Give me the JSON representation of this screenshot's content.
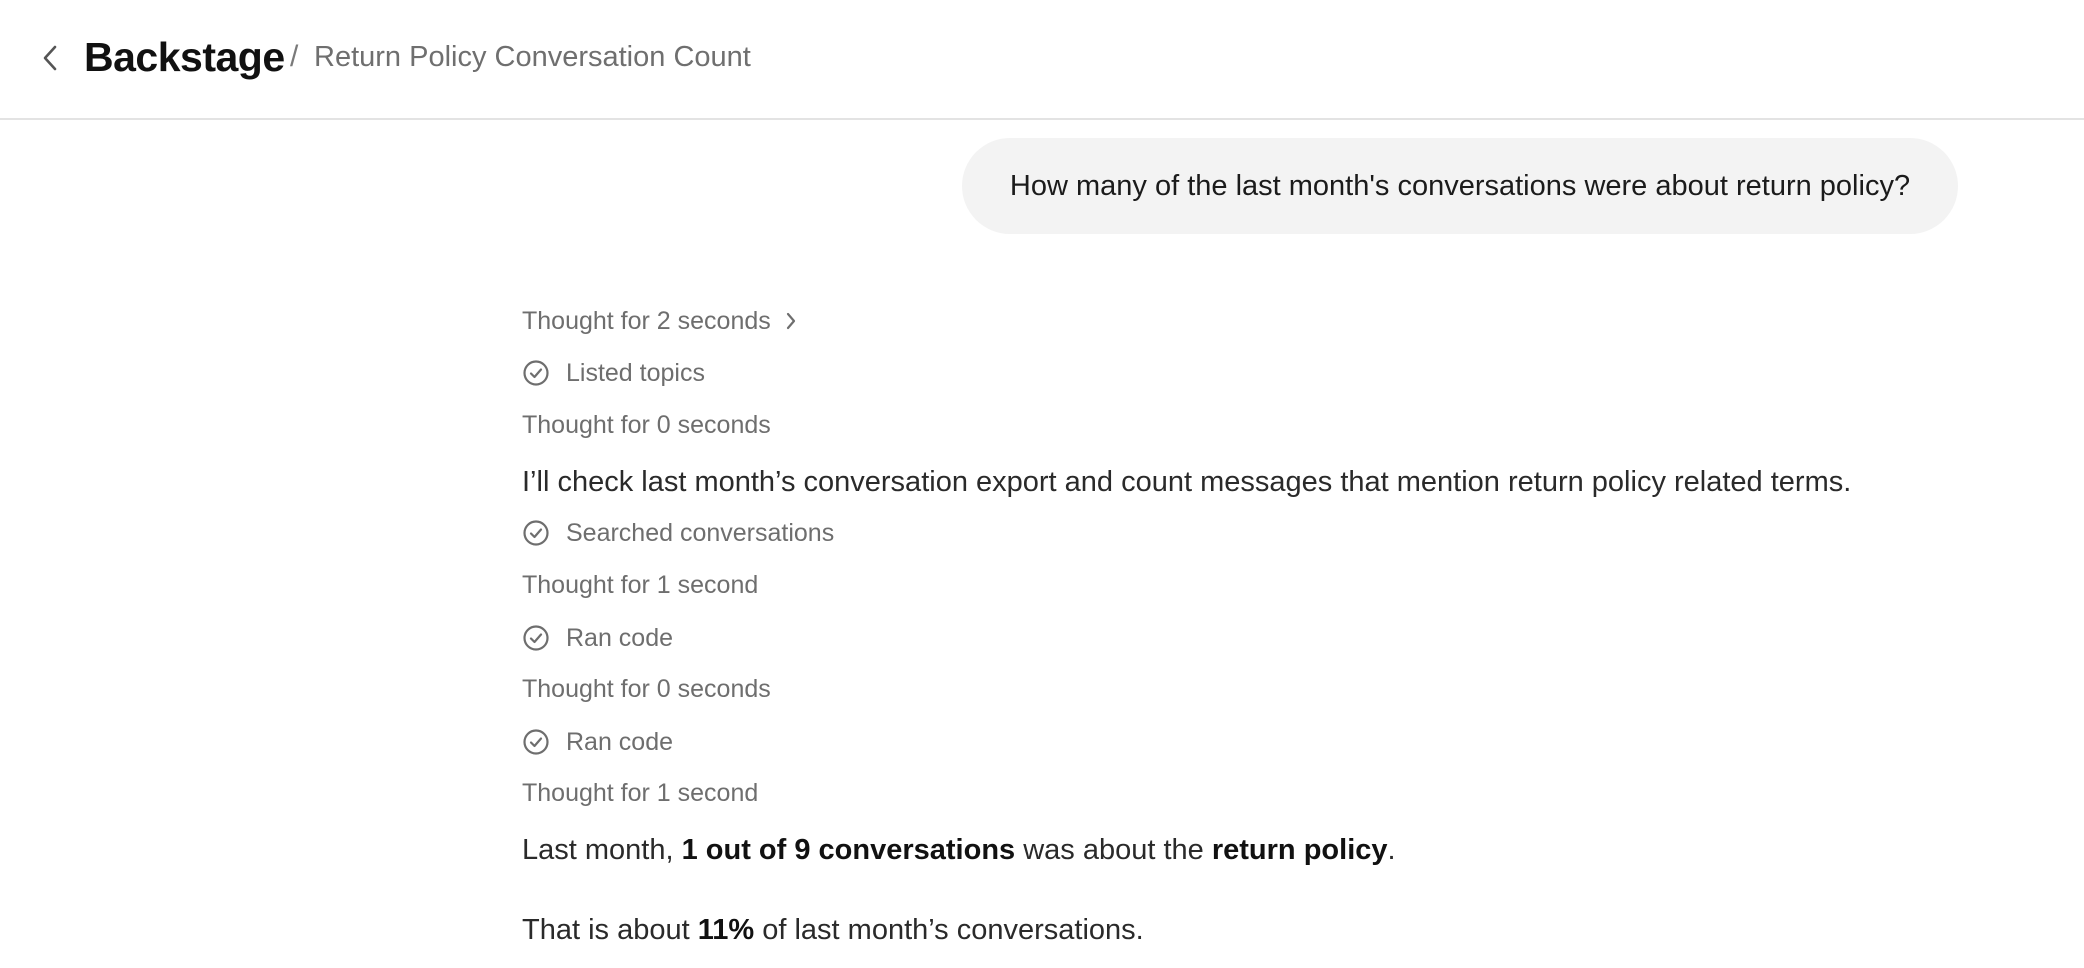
{
  "header": {
    "brand": "Backstage",
    "separator": "/",
    "title": "Return Policy Conversation Count"
  },
  "user_message": "How many of the last month's conversations were about return policy?",
  "steps": {
    "thought_1": "Thought for 2 seconds",
    "tool_1": "Listed topics",
    "thought_2": "Thought for 0 seconds",
    "tool_2": "Searched conversations",
    "thought_3": "Thought for 1 second",
    "tool_3": "Ran code",
    "thought_4": "Thought for 0 seconds",
    "tool_4": "Ran code",
    "thought_5": "Thought for 1 second"
  },
  "assistant": {
    "plan": "I’ll check last month’s conversation export and count messages that mention return policy related terms.",
    "answer_prefix": "Last month, ",
    "answer_bold_1": "1 out of 9 conversations",
    "answer_middle": " was about the ",
    "answer_bold_2": "return policy",
    "answer_suffix": ".",
    "share_prefix": "That is about ",
    "share_bold": "11%",
    "share_suffix": " of last month’s conversations."
  },
  "icons": {
    "back": "chevron-left-icon",
    "expand": "chevron-right-icon",
    "done": "check-circle-icon"
  }
}
